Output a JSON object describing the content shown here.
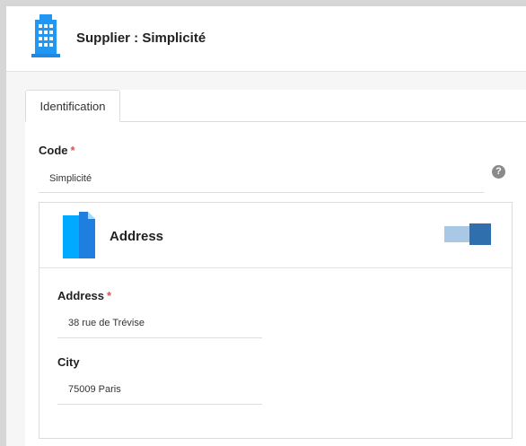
{
  "header": {
    "title": "Supplier : Simplicité",
    "icon": "building-icon"
  },
  "tabs": [
    {
      "label": "Identification"
    }
  ],
  "form": {
    "code": {
      "label": "Code",
      "required_mark": "*",
      "value": "Simplicité",
      "help": "?"
    },
    "address_card": {
      "title": "Address",
      "icon": "document-icon",
      "toggle_icon": "collapse-toggle-icon",
      "address": {
        "label": "Address",
        "required_mark": "*",
        "value": "38 rue de Trévise"
      },
      "city": {
        "label": "City",
        "value": "75009 Paris"
      }
    }
  },
  "colors": {
    "accent": "#2196f3",
    "toggle_light": "#a8c8e6",
    "toggle_dark": "#2f6fad",
    "required": "#d9534f"
  }
}
